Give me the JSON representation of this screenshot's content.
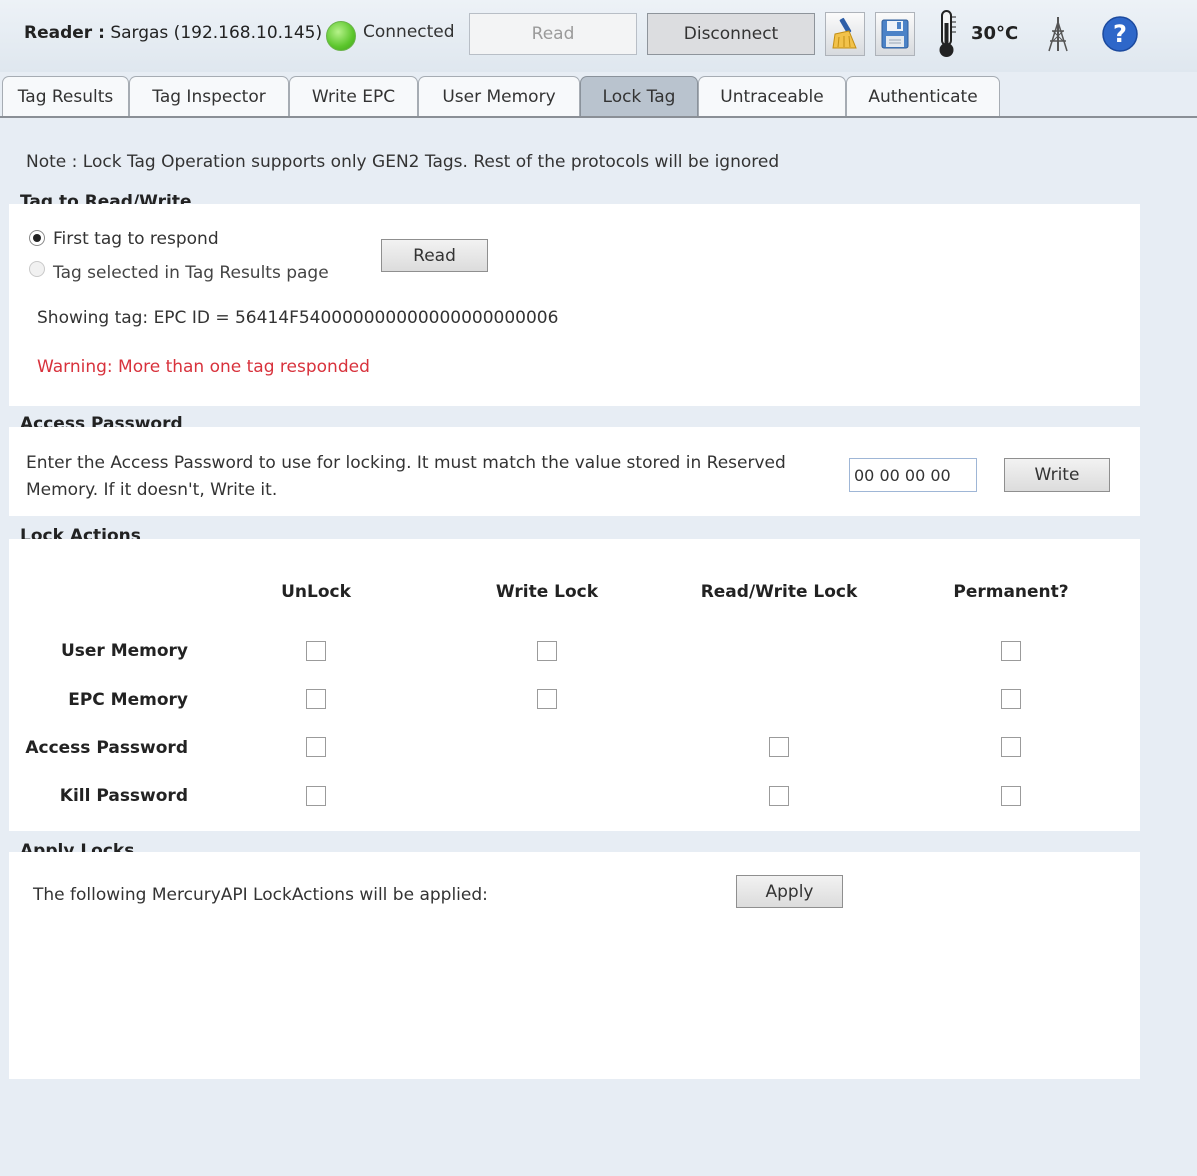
{
  "toolbar": {
    "reader_prefix": "Reader :",
    "reader_name": "Sargas (192.168.10.145)",
    "status": "Connected",
    "status_color": "#5cc62c",
    "read_label": "Read",
    "disconnect_label": "Disconnect",
    "clean_icon": "broom-icon",
    "save_icon": "save-icon",
    "temperature_icon": "thermometer-icon",
    "temperature": "30°C",
    "antenna_icon": "antenna-icon",
    "help_icon": "help-icon"
  },
  "tabs": [
    {
      "label": "Tag Results",
      "active": false
    },
    {
      "label": "Tag Inspector",
      "active": false
    },
    {
      "label": "Write EPC",
      "active": false
    },
    {
      "label": "User Memory",
      "active": false
    },
    {
      "label": "Lock Tag",
      "active": true
    },
    {
      "label": "Untraceable",
      "active": false
    },
    {
      "label": "Authenticate",
      "active": false
    }
  ],
  "note": "Note : Lock Tag Operation supports only GEN2 Tags. Rest of the protocols will be ignored",
  "tag_section": {
    "title": "Tag to Read/Write",
    "option_first": "First tag to respond",
    "option_selected": "Tag selected in Tag Results page",
    "read_label": "Read",
    "showing_tag": "Showing tag: EPC ID = 56414F540000000000000000000006",
    "warning": "Warning: More than one tag responded",
    "warning_color": "#d8323c"
  },
  "access_section": {
    "title": "Access Password",
    "description_line1": "Enter the Access Password to use for locking. It must match the value stored in Reserved",
    "description_line2": "Memory. If it doesn't, Write it.",
    "password_value": "00 00 00 00",
    "write_label": "Write"
  },
  "lock_section": {
    "title": "Lock Actions",
    "columns": [
      "UnLock",
      "Write Lock",
      "Read/Write Lock",
      "Permanent?"
    ],
    "rows": [
      "User Memory",
      "EPC Memory",
      "Access Password",
      "Kill Password"
    ]
  },
  "apply_section": {
    "title": "Apply Locks",
    "description": "The following MercuryAPI LockActions will be applied:",
    "apply_label": "Apply"
  }
}
